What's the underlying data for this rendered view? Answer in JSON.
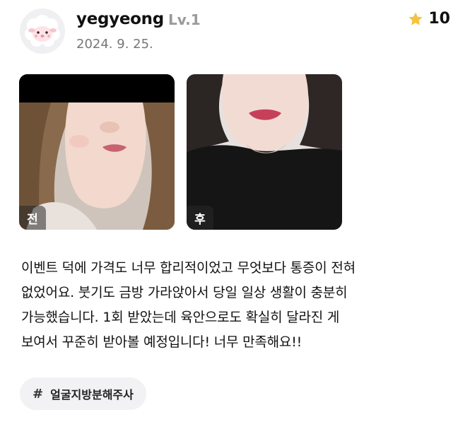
{
  "user": {
    "name": "yegyeong",
    "level": "Lv.1",
    "date": "2024. 9. 25."
  },
  "rating": {
    "score": "10",
    "star_color": "#f5c242"
  },
  "photos": [
    {
      "label": "전"
    },
    {
      "label": "후"
    }
  ],
  "review": {
    "lines": [
      "이벤트 덕에 가격도 너무 합리적이었고 무엇보다 통증이 전혀",
      "없었어요. 붓기도 금방 가라앉아서 당일 일상 생활이 충분히",
      "가능했습니다. 1회 받았는데 육안으로도 확실히 달라진 게",
      "보여서 꾸준히 받아볼 예정입니다! 너무 만족해요!!"
    ]
  },
  "tag": {
    "hash": "#",
    "label": "얼굴지방분해주사"
  }
}
